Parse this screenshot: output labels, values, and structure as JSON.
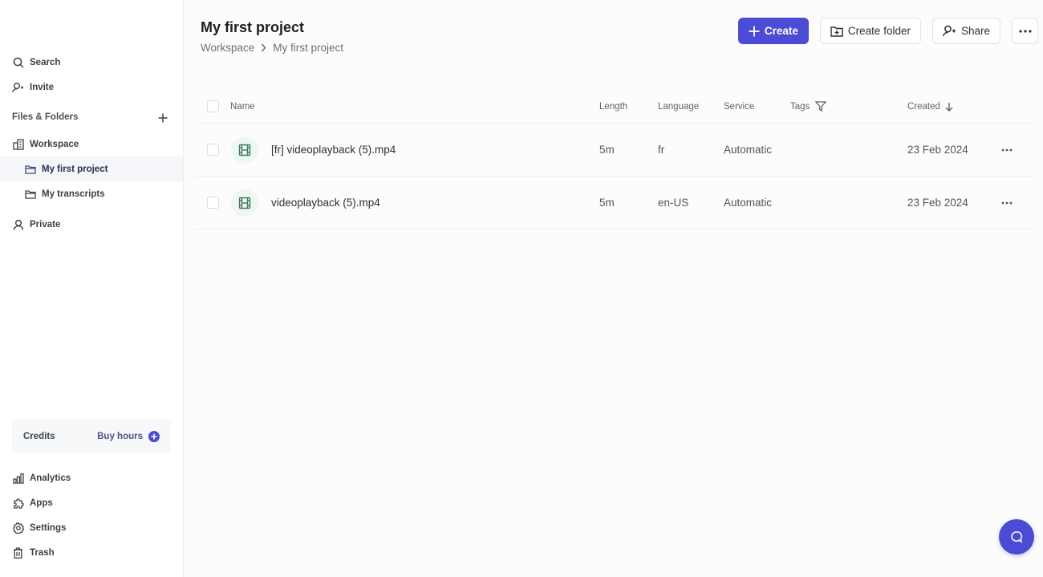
{
  "sidebar": {
    "search": "Search",
    "invite": "Invite",
    "section_label": "Files & Folders",
    "workspace": "Workspace",
    "folders": [
      "My first project",
      "My transcripts"
    ],
    "private": "Private",
    "credits_label": "Credits",
    "buy_hours": "Buy hours",
    "bottom": [
      "Analytics",
      "Apps",
      "Settings",
      "Trash"
    ]
  },
  "header": {
    "title": "My first project",
    "breadcrumb": [
      "Workspace",
      "My first project"
    ]
  },
  "toolbar": {
    "create": "Create",
    "create_folder": "Create folder",
    "share": "Share"
  },
  "colors": {
    "accent": "#4b4bd6",
    "file_icon": "#3f7a5e"
  },
  "table": {
    "columns": {
      "name": "Name",
      "length": "Length",
      "language": "Language",
      "service": "Service",
      "tags": "Tags",
      "created": "Created"
    },
    "sort": "created-desc",
    "rows": [
      {
        "name": "[fr] videoplayback (5).mp4",
        "length": "5m",
        "language": "fr",
        "service": "Automatic",
        "tags": "",
        "created": "23 Feb 2024"
      },
      {
        "name": "videoplayback (5).mp4",
        "length": "5m",
        "language": "en-US",
        "service": "Automatic",
        "tags": "",
        "created": "23 Feb 2024"
      }
    ]
  }
}
